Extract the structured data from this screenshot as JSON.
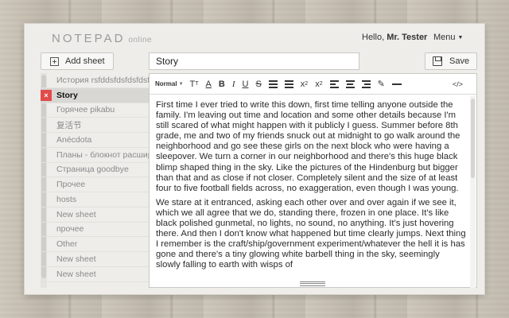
{
  "app": {
    "logo_main": "NOTEPAD",
    "logo_sub": "online",
    "greeting": "Hello,",
    "user_name": "Mr. Tester",
    "menu_label": "Menu"
  },
  "sidebar": {
    "add_label": "Add sheet",
    "sheets": [
      {
        "label": "История rsfddsfdsfdsfdsf",
        "active": false
      },
      {
        "label": "Story",
        "active": true
      },
      {
        "label": "Горячее pikabu",
        "active": false
      },
      {
        "label": "复活节",
        "active": false
      },
      {
        "label": "Anécdota",
        "active": false
      },
      {
        "label": "Планы - блокнот расшир",
        "active": false
      },
      {
        "label": "Страница goodbye",
        "active": false
      },
      {
        "label": "Прочее",
        "active": false
      },
      {
        "label": "hosts",
        "active": false
      },
      {
        "label": "New sheet",
        "active": false
      },
      {
        "label": "прочее",
        "active": false
      },
      {
        "label": "Other",
        "active": false
      },
      {
        "label": "New sheet",
        "active": false
      },
      {
        "label": "New sheet",
        "active": false
      }
    ],
    "delete_glyph": "×"
  },
  "editor": {
    "title_value": "Story",
    "save_label": "Save",
    "toolbar": {
      "format": "Normal",
      "font_size": "T",
      "font_color": "A",
      "bold": "B",
      "italic": "I",
      "underline": "U",
      "strike": "S",
      "subscript": "x",
      "sub_mark": "2",
      "superscript": "x",
      "sup_mark": "2",
      "code": "</>"
    },
    "paragraphs": [
      "First time I ever tried to write this down, first time telling anyone outside the family. I'm leaving out time and location and some other details because I'm still scared of what might happen with it publicly I guess. Summer before 8th grade, me and two of my friends snuck out at midnight to go walk around the neighborhood and go see these girls on the next block who were having a sleepover. We turn a corner in our neighborhood and there's this huge black blimp shaped thing in the sky. Like the pictures of the Hindenburg but bigger than that and as close if not closer. Completely silent and the size of at least four to five football fields across, no exaggeration, even though I was young.",
      "We stare at it entranced, asking each other over and over again if we see it, which we all agree that we do, standing there, frozen in one place. It's like black polished gunmetal, no lights, no sound, no anything. It's just hovering there. And then I don't know what happened but time clearly jumps. Next thing I remember is the craft/ship/government experiment/whatever the hell it is has gone and there's a tiny glowing white barbell thing in the sky, seemingly slowly falling to earth with wisps of"
    ]
  }
}
